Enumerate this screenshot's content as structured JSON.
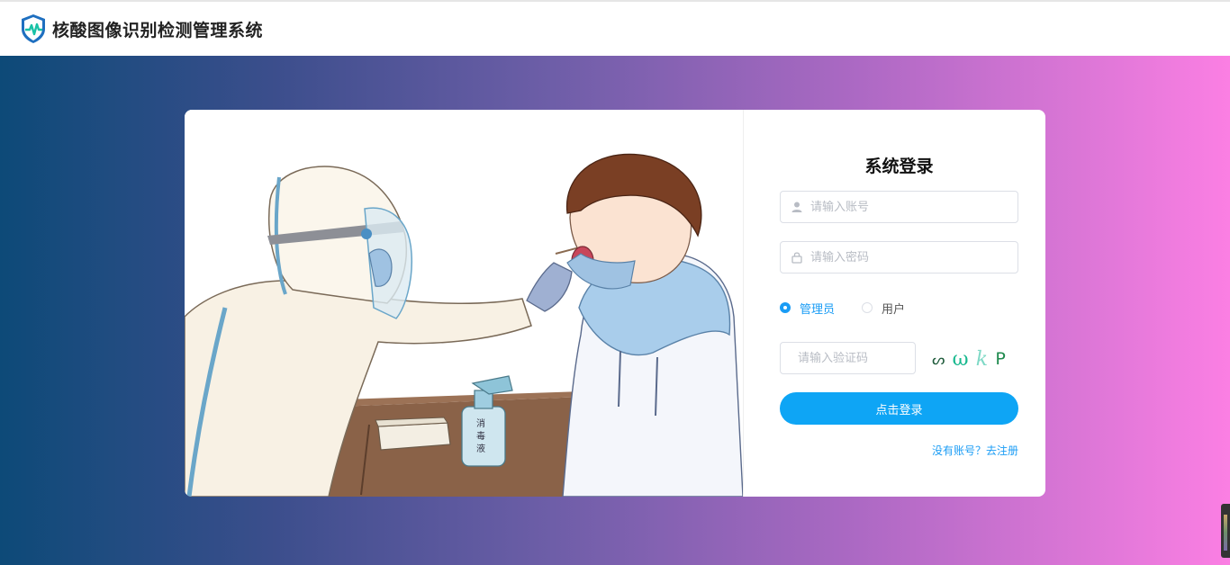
{
  "header": {
    "title": "核酸图像识别检测管理系统",
    "logo_icon": "shield-heartbeat-icon"
  },
  "login": {
    "title": "系统登录",
    "username": {
      "value": "",
      "placeholder": "请输入账号",
      "icon": "user-icon"
    },
    "password": {
      "value": "",
      "placeholder": "请输入密码",
      "icon": "lock-icon"
    },
    "roles": [
      {
        "label": "管理员",
        "checked": true
      },
      {
        "label": "用户",
        "checked": false
      }
    ],
    "captcha_input": {
      "value": "",
      "placeholder": "请输入验证码",
      "icon": "key-icon"
    },
    "captcha_chars": [
      "ᔕ",
      "ω",
      "k",
      "P"
    ],
    "submit_label": "点击登录",
    "register_label": "没有账号？去注册"
  },
  "illustration": {
    "bottle_label": "消毒液"
  },
  "colors": {
    "accent": "#0ea5f5",
    "gradient_start": "#0d4a78",
    "gradient_end": "#fb7fe3"
  }
}
